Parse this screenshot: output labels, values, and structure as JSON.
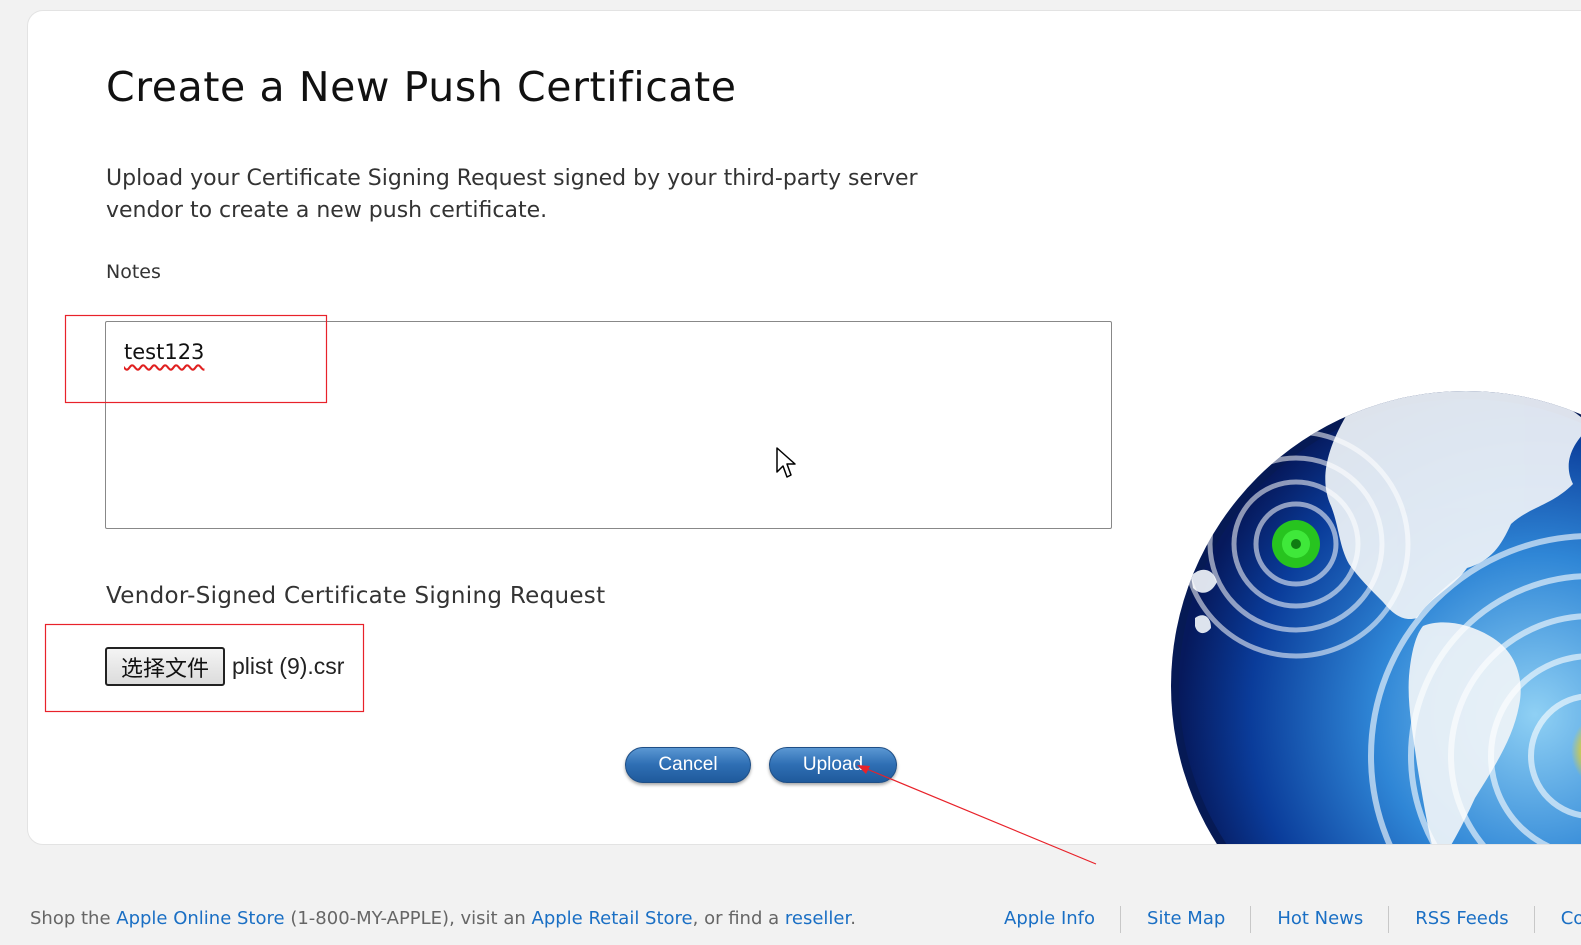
{
  "page": {
    "title": "Create a New Push Certificate",
    "intro": "Upload your Certificate Signing Request signed by your third-party server vendor to create a new push certificate."
  },
  "notes": {
    "label": "Notes",
    "value": "test123"
  },
  "csr": {
    "label": "Vendor-Signed Certificate Signing Request",
    "choose_file_label": "选择文件",
    "file_name": "plist (9).csr"
  },
  "actions": {
    "cancel_label": "Cancel",
    "upload_label": "Upload"
  },
  "footer": {
    "shop_prefix": "Shop the ",
    "online_store_label": "Apple Online Store",
    "phone_text": " (1-800-MY-APPLE), visit an ",
    "retail_store_label": "Apple Retail Store",
    "find_text": ", or find a ",
    "reseller_label": "reseller",
    "end_text": ".",
    "nav": [
      {
        "label": "Apple Info"
      },
      {
        "label": "Site Map"
      },
      {
        "label": "Hot News"
      },
      {
        "label": "RSS Feeds"
      },
      {
        "label": "Cor"
      }
    ]
  },
  "colors": {
    "accent": "#2f6fb4",
    "link": "#1a6fc4",
    "annotation": "#e8222a"
  },
  "icons": {
    "globe": "globe-icon",
    "cursor": "mouse-cursor-icon"
  }
}
